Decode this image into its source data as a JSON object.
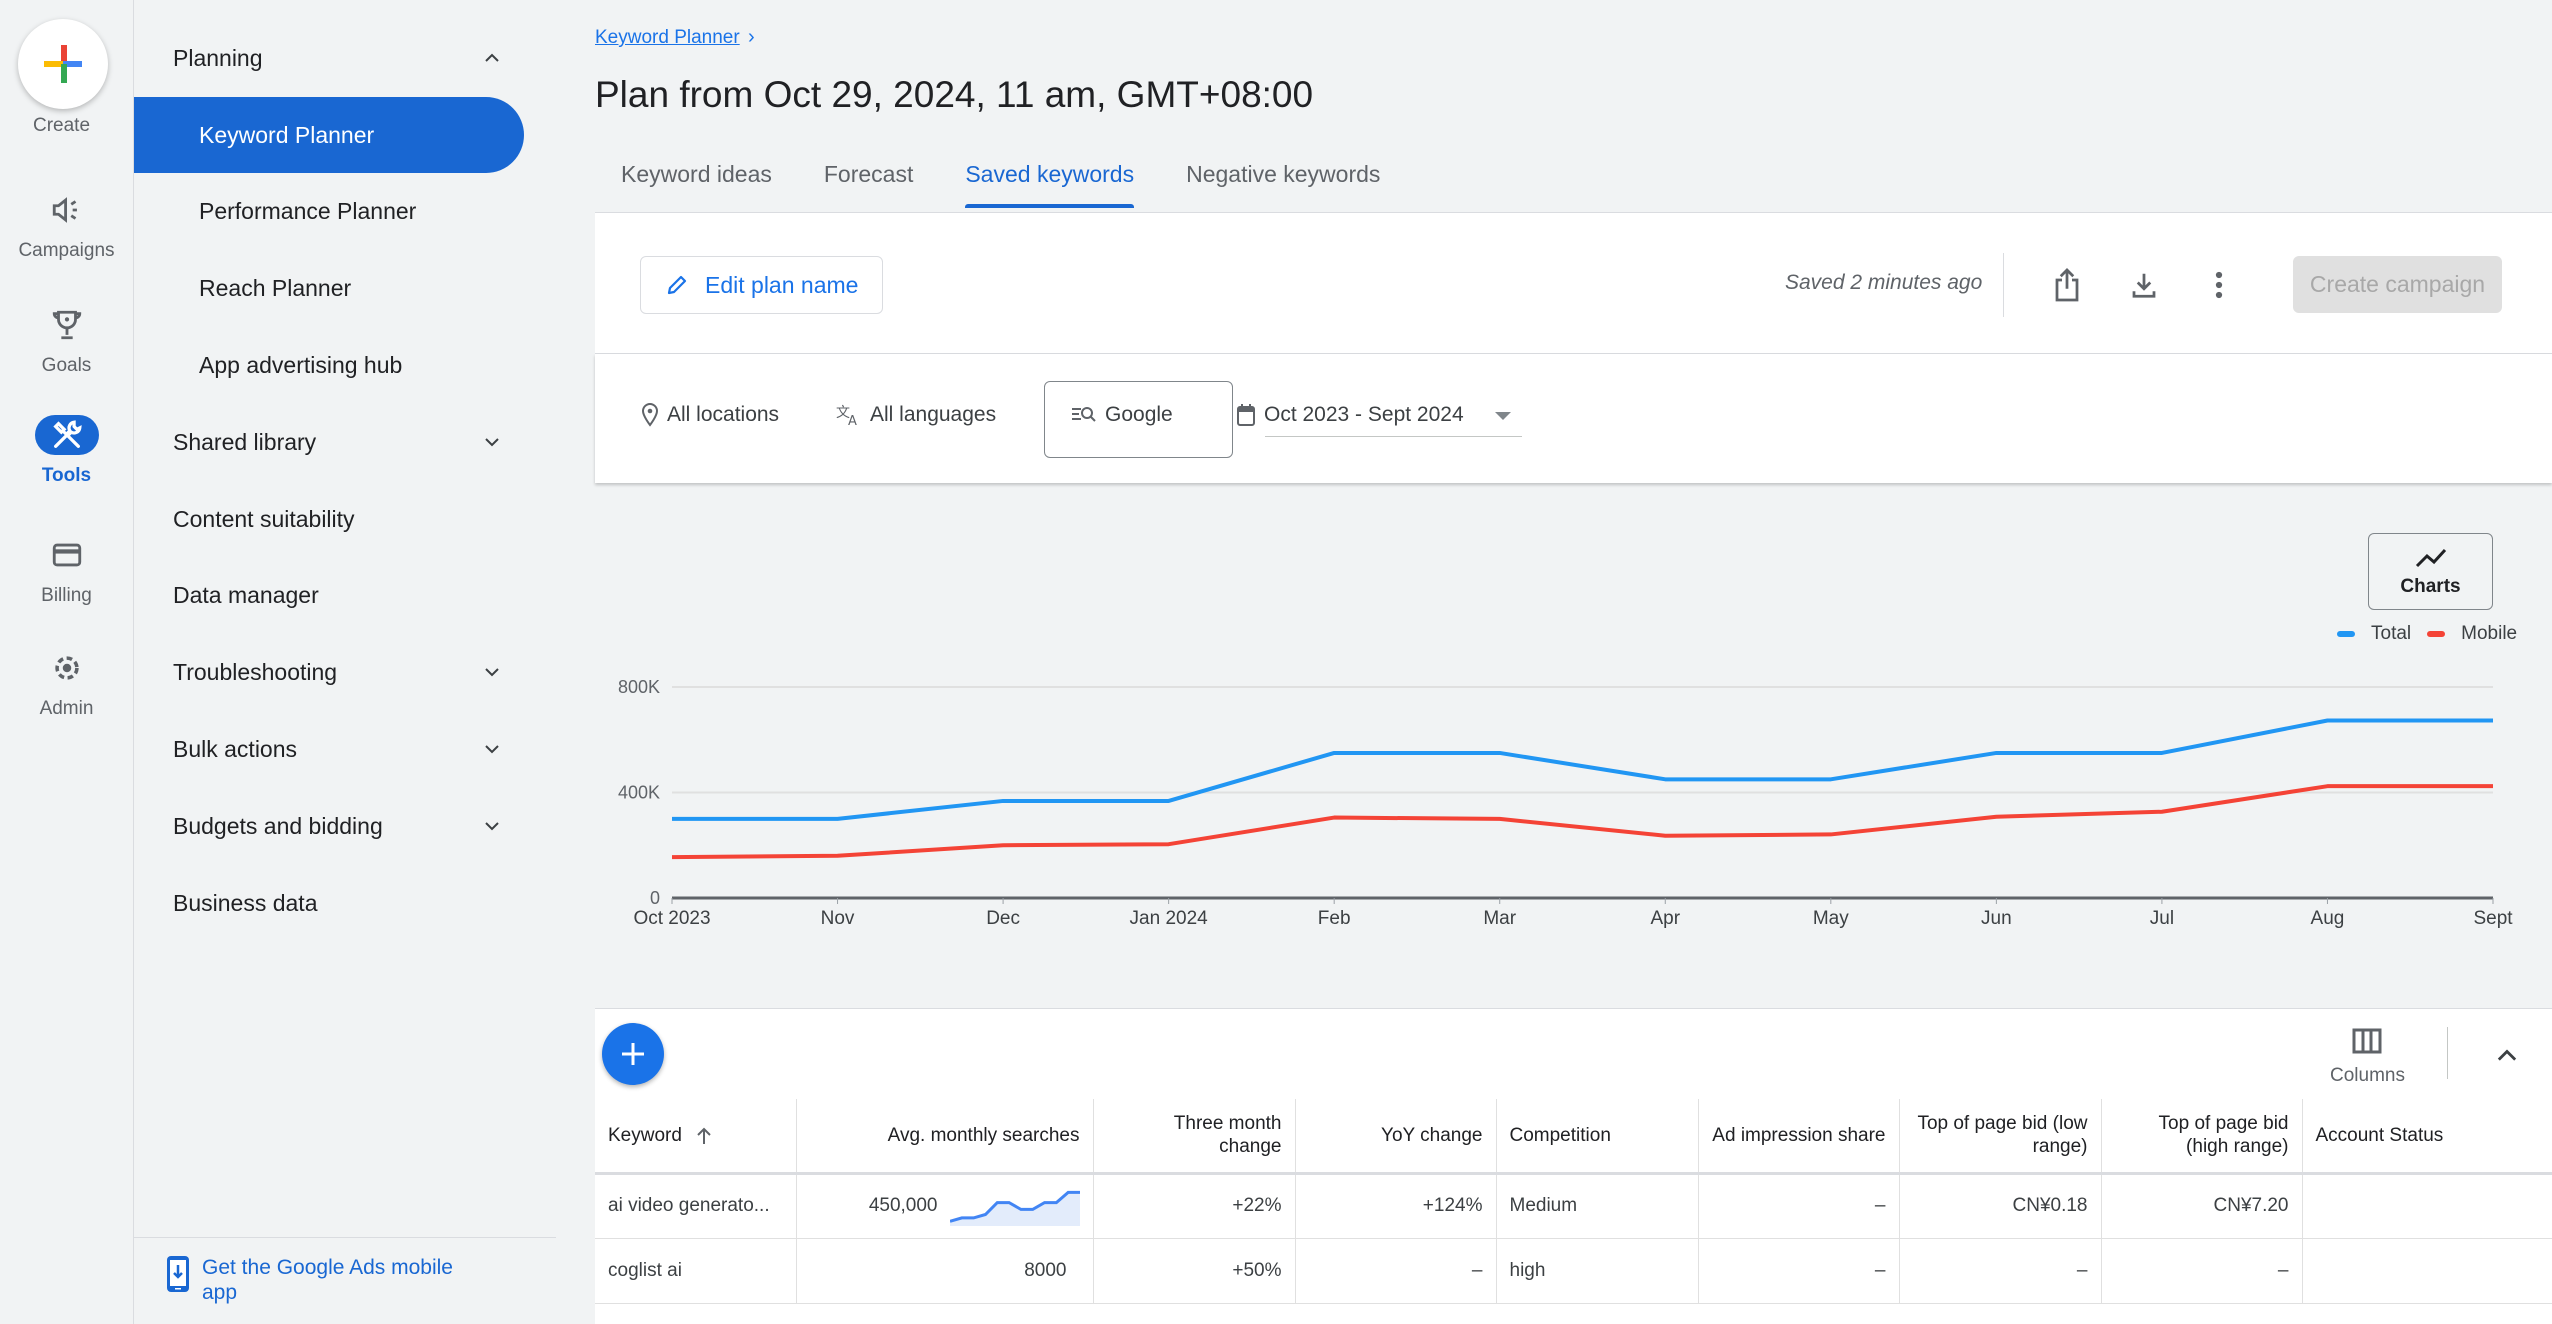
{
  "rail": {
    "create_label": "Create",
    "items": [
      {
        "label": "Campaigns",
        "icon": "megaphone-icon"
      },
      {
        "label": "Goals",
        "icon": "trophy-icon"
      },
      {
        "label": "Tools",
        "icon": "tools-icon",
        "active": true
      },
      {
        "label": "Billing",
        "icon": "credit-card-icon"
      },
      {
        "label": "Admin",
        "icon": "gear-icon"
      }
    ]
  },
  "nav": {
    "items": [
      {
        "label": "Planning",
        "expanded": true
      },
      {
        "label": "Keyword Planner",
        "sub": true,
        "active": true
      },
      {
        "label": "Performance Planner",
        "sub": true
      },
      {
        "label": "Reach Planner",
        "sub": true
      },
      {
        "label": "App advertising hub",
        "sub": true
      },
      {
        "label": "Shared library",
        "expandable": true
      },
      {
        "label": "Content suitability"
      },
      {
        "label": "Data manager"
      },
      {
        "label": "Troubleshooting",
        "expandable": true
      },
      {
        "label": "Bulk actions",
        "expandable": true
      },
      {
        "label": "Budgets and bidding",
        "expandable": true
      },
      {
        "label": "Business data"
      }
    ],
    "footer_link": "Get the Google Ads mobile app"
  },
  "header": {
    "breadcrumb": "Keyword Planner",
    "title": "Plan from Oct 29, 2024, 11 am, GMT+08:00",
    "tabs": [
      {
        "label": "Keyword ideas"
      },
      {
        "label": "Forecast"
      },
      {
        "label": "Saved keywords",
        "active": true
      },
      {
        "label": "Negative keywords"
      }
    ]
  },
  "toolbar": {
    "edit_label": "Edit plan name",
    "saved_status": "Saved 2 minutes ago",
    "create_campaign_label": "Create campaign"
  },
  "filters": {
    "location": "All locations",
    "language": "All languages",
    "network": "Google",
    "date_range": "Oct 2023 - Sept 2024"
  },
  "chart_controls": {
    "charts_label": "Charts"
  },
  "colors": {
    "accent": "#1967d2",
    "total": "#2196f3",
    "mobile": "#f44336"
  },
  "chart_data": {
    "type": "line",
    "title": "",
    "xlabel": "",
    "ylabel": "",
    "categories": [
      "Oct 2023",
      "Nov",
      "Dec",
      "Jan 2024",
      "Feb",
      "Mar",
      "Apr",
      "May",
      "Jun",
      "Jul",
      "Aug",
      "Sept"
    ],
    "series": [
      {
        "name": "Total",
        "color": "#2196f3",
        "values": [
          300000,
          300000,
          368000,
          368000,
          550000,
          550000,
          450000,
          450000,
          550000,
          550000,
          673000,
          673000
        ]
      },
      {
        "name": "Mobile",
        "color": "#f44336",
        "values": [
          155000,
          160000,
          200000,
          204000,
          305000,
          300000,
          236000,
          241000,
          308000,
          327000,
          424000,
          424000
        ]
      }
    ],
    "yticks": [
      0,
      400000,
      800000
    ],
    "ytick_labels": [
      "0",
      "400K",
      "800K"
    ],
    "ylim": [
      0,
      800000
    ],
    "grid": true,
    "legend": "top-right"
  },
  "table": {
    "columns": [
      "Keyword",
      "Avg. monthly searches",
      "Three month change",
      "YoY change",
      "Competition",
      "Ad impression share",
      "Top of page bid (low range)",
      "Top of page bid (high range)",
      "Account Status"
    ],
    "columns_label": "Columns",
    "rows": [
      {
        "keyword": "ai video generato...",
        "avg": "450,000",
        "has_trend": true,
        "three_month": "+22%",
        "yoy": "+124%",
        "competition": "Medium",
        "impression": "–",
        "bid_low": "CN¥0.18",
        "bid_high": "CN¥7.20",
        "status": ""
      },
      {
        "keyword": "coglist ai",
        "avg": "8000",
        "has_trend": false,
        "three_month": "+50%",
        "yoy": "–",
        "competition": "high",
        "impression": "–",
        "bid_low": "–",
        "bid_high": "–",
        "status": ""
      }
    ],
    "trend_sparkline": [
      0.05,
      0.15,
      0.15,
      0.25,
      0.6,
      0.6,
      0.4,
      0.4,
      0.6,
      0.6,
      0.9,
      0.9
    ]
  }
}
